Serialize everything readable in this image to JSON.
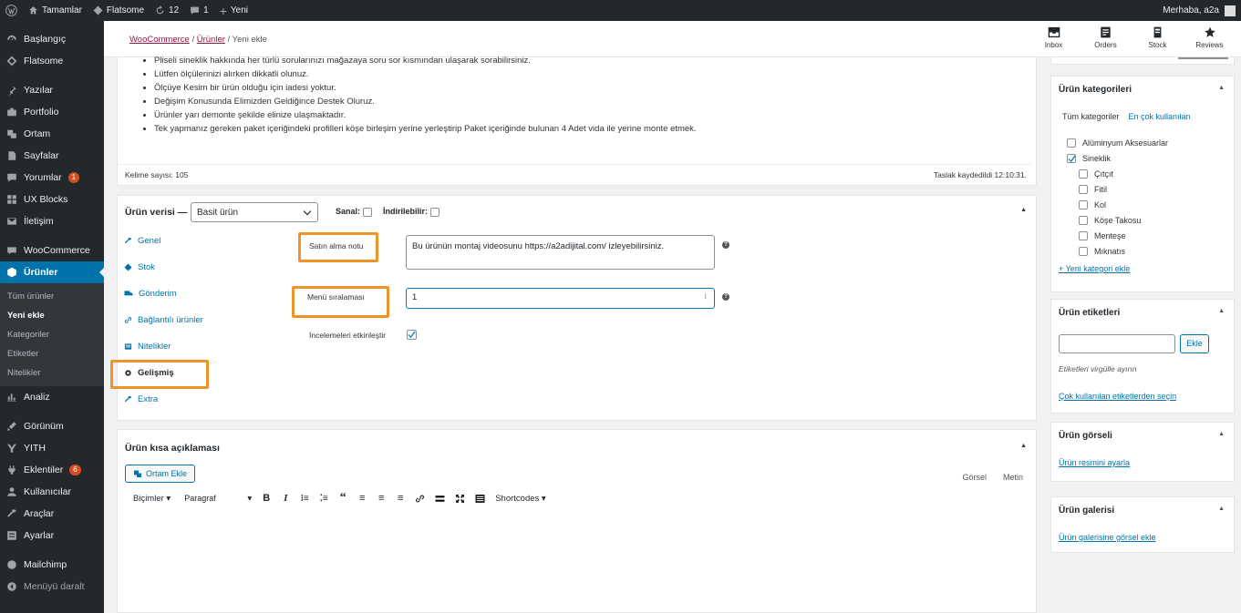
{
  "adminbar": {
    "site": "Tamamlar",
    "theme": "Flatsome",
    "updates": "12",
    "comments": "1",
    "new": "Yeni",
    "greeting": "Merhaba, a2a"
  },
  "sidebar": {
    "items": [
      {
        "label": "Başlangıç",
        "icon": "dashboard-icon"
      },
      {
        "label": "Flatsome",
        "icon": "flatsome-icon"
      },
      {
        "label": "Yazılar",
        "icon": "pin-icon"
      },
      {
        "label": "Portfolio",
        "icon": "portfolio-icon"
      },
      {
        "label": "Ortam",
        "icon": "media-icon"
      },
      {
        "label": "Sayfalar",
        "icon": "pages-icon"
      },
      {
        "label": "Yorumlar",
        "icon": "comments-icon",
        "badge": "1"
      },
      {
        "label": "UX Blocks",
        "icon": "blocks-icon"
      },
      {
        "label": "İletişim",
        "icon": "mail-icon"
      },
      {
        "label": "WooCommerce",
        "icon": "woo-icon"
      },
      {
        "label": "Ürünler",
        "icon": "products-icon"
      },
      {
        "label": "Analiz",
        "icon": "chart-icon"
      },
      {
        "label": "Görünüm",
        "icon": "appearance-icon"
      },
      {
        "label": "YITH",
        "icon": "yith-icon"
      },
      {
        "label": "Eklentiler",
        "icon": "plugins-icon",
        "badge": "6"
      },
      {
        "label": "Kullanıcılar",
        "icon": "users-icon"
      },
      {
        "label": "Araçlar",
        "icon": "tools-icon"
      },
      {
        "label": "Ayarlar",
        "icon": "settings-icon"
      },
      {
        "label": "Mailchimp",
        "icon": "mailchimp-icon"
      },
      {
        "label": "Menüyü daralt",
        "icon": "collapse-icon"
      }
    ],
    "submenu": [
      "Tüm ürünler",
      "Yeni ekle",
      "Kategoriler",
      "Etiketler",
      "Nitelikler"
    ]
  },
  "topbar": {
    "breadcrumb": {
      "root": "WooCommerce",
      "parent": "Ürünler",
      "current": "Yeni ekle"
    },
    "icons": [
      {
        "label": "Inbox",
        "icon": "inbox-icon"
      },
      {
        "label": "Orders",
        "icon": "orders-icon"
      },
      {
        "label": "Stock",
        "icon": "stock-icon"
      },
      {
        "label": "Reviews",
        "icon": "reviews-icon"
      }
    ]
  },
  "description": {
    "bullets": [
      "Pliseli sineklik hakkında her türlü sorularınızı mağazaya soru sor kısmından ulaşarak sorabilirsiniz.",
      "Lütfen ölçülerinizi alırken dikkatli olunuz.",
      "Ölçüye Kesim bir ürün olduğu için iadesi yoktur.",
      "Değişim Konusunda Elimizden Geldiğince Destek Oluruz.",
      "Ürünler yarı demonte şekilde elinize ulaşmaktadır.",
      "Tek yapmanız gereken paket içeriğindeki profilleri köşe birleşim yerine yerleştirip Paket içeriğinde bulunan 4 Adet vida ile yerine monte etmek."
    ],
    "word_count": "Kelime sayısı: 105",
    "draft_saved": "Taslak kaydedildi 12:10:31."
  },
  "product_data": {
    "title": "Ürün verisi —",
    "type_select": "Basit ürün",
    "virtual_label": "Sanal:",
    "downloadable_label": "İndirilebilir:",
    "tabs": [
      {
        "label": "Genel",
        "icon": "wrench-icon"
      },
      {
        "label": "Stok",
        "icon": "inventory-icon"
      },
      {
        "label": "Gönderim",
        "icon": "truck-icon"
      },
      {
        "label": "Bağlantılı ürünler",
        "icon": "link-icon"
      },
      {
        "label": "Nitelikler",
        "icon": "list-icon"
      },
      {
        "label": "Gelişmiş",
        "icon": "gear-icon"
      },
      {
        "label": "Extra",
        "icon": "wrench-icon"
      }
    ],
    "purchase_note_label": "Satın alma notu",
    "purchase_note_value": "Bu ürünün montaj videosunu https://a2adijital.com/ izleyebilirsiniz.",
    "menu_order_label": "Menü sıralaması",
    "menu_order_value": "1",
    "reviews_label": "İncelemeleri etkinleştir"
  },
  "short_desc": {
    "title": "Ürün kısa açıklaması",
    "add_media": "Ortam Ekle",
    "visual_tab": "Görsel",
    "text_tab": "Metin",
    "format_select": "Biçimler",
    "paragraph_select": "Paragraf",
    "shortcodes": "Shortcodes"
  },
  "categories": {
    "title": "Ürün kategorileri",
    "tab_all": "Tüm kategoriler",
    "tab_popular": "En çok kullanılan",
    "items": [
      {
        "label": "Alüminyum Aksesuarlar",
        "checked": false,
        "child": false
      },
      {
        "label": "Sineklik",
        "checked": true,
        "child": false
      },
      {
        "label": "Çıtçıt",
        "checked": false,
        "child": true
      },
      {
        "label": "Fitil",
        "checked": false,
        "child": true
      },
      {
        "label": "Kol",
        "checked": false,
        "child": true
      },
      {
        "label": "Köşe Takosu",
        "checked": false,
        "child": true
      },
      {
        "label": "Menteşe",
        "checked": false,
        "child": true
      },
      {
        "label": "Mıknatıs",
        "checked": false,
        "child": true
      }
    ],
    "add_new": "+ Yeni kategori ekle"
  },
  "tags": {
    "title": "Ürün etiketleri",
    "add_button": "Ekle",
    "hint": "Etiketleri virgülle ayırın",
    "popular_link": "Çok kullanılan etiketlerden seçin"
  },
  "image": {
    "title": "Ürün görseli",
    "link": "Ürün resmini ayarla"
  },
  "gallery": {
    "title": "Ürün galerisi",
    "link": "Ürün galerisine görsel ekle"
  },
  "colors": {
    "accent": "#0073aa",
    "highlight": "#f0932b",
    "adminbar": "#23282d",
    "badge": "#d54e21"
  }
}
